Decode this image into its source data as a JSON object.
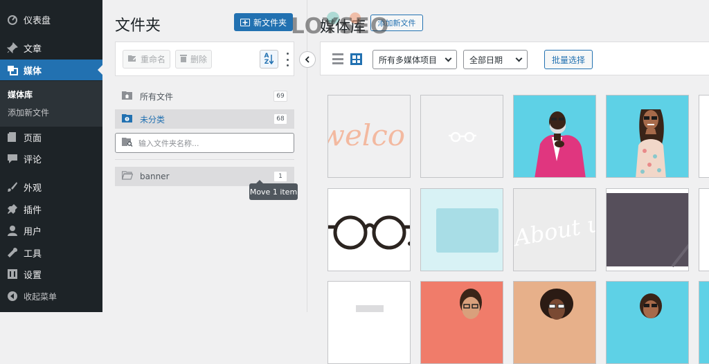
{
  "sidebar": {
    "items": [
      {
        "label": "仪表盘",
        "icon": "dashboard-icon"
      },
      {
        "label": "文章",
        "icon": "pin-icon"
      },
      {
        "label": "媒体",
        "icon": "media-icon"
      },
      {
        "label": "页面",
        "icon": "page-icon"
      },
      {
        "label": "评论",
        "icon": "comment-icon"
      },
      {
        "label": "外观",
        "icon": "brush-icon"
      },
      {
        "label": "插件",
        "icon": "plugin-icon"
      },
      {
        "label": "用户",
        "icon": "user-icon"
      },
      {
        "label": "工具",
        "icon": "wrench-icon"
      },
      {
        "label": "设置",
        "icon": "settings-icon"
      },
      {
        "label": "收起菜单",
        "icon": "collapse-icon"
      }
    ],
    "submenu": {
      "current": "媒体库",
      "add_new": "添加新文件"
    }
  },
  "folders": {
    "title": "文件夹",
    "new_folder_button": "新文件夹",
    "rename_button": "重命名",
    "delete_button": "删除",
    "sort_label_top": "A",
    "sort_label_bottom": "Z",
    "items": [
      {
        "label": "所有文件",
        "count": "69"
      },
      {
        "label": "未分类",
        "count": "68"
      }
    ],
    "search_placeholder": "输入文件夹名称...",
    "user_folders": [
      {
        "label": "banner",
        "count": "1"
      }
    ],
    "tooltip": "Move 1 item"
  },
  "library": {
    "title": "媒体库",
    "add_new_button": "添加新文件",
    "type_filter": "所有多媒体项目",
    "date_filter": "全部日期",
    "bulk_select_button": "批量选择"
  },
  "watermark": "LOYSEO",
  "colors": {
    "admin_bg": "#1d2327",
    "accent": "#2271b1",
    "page_bg": "#f0f0f1"
  }
}
